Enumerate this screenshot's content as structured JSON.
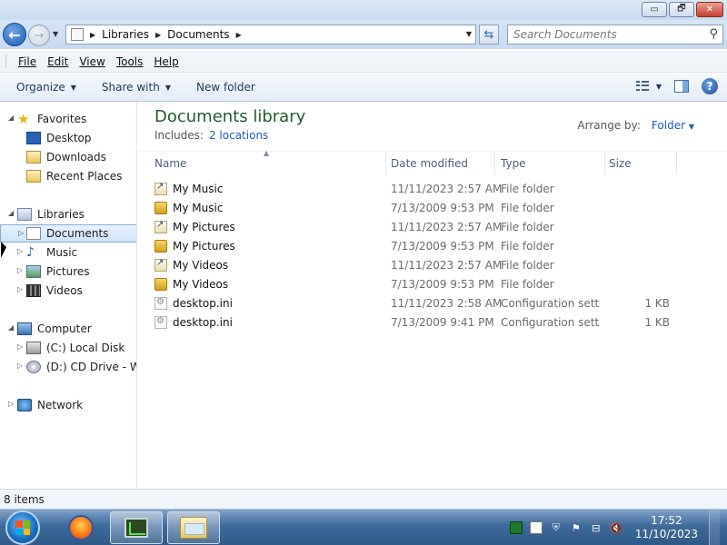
{
  "window": {
    "minimize_glyph": "▭",
    "maximize_glyph": "🗗",
    "close_glyph": "✕"
  },
  "navigation": {
    "back_glyph": "←",
    "forward_glyph": "→",
    "history_glyph": "▼"
  },
  "address": {
    "crumbs": [
      "Libraries",
      "Documents"
    ],
    "separator": "▶",
    "refresh_glyph": "⇆"
  },
  "search": {
    "placeholder": "Search Documents",
    "icon": "search-icon",
    "glyph": "⚲"
  },
  "menubar": {
    "items": [
      "File",
      "Edit",
      "View",
      "Tools",
      "Help"
    ]
  },
  "toolbar": {
    "organize": "Organize",
    "share_with": "Share with",
    "new_folder": "New folder",
    "caret": "▼",
    "help": "?"
  },
  "navpane": {
    "items": [
      {
        "label": "Favorites",
        "icon": "star-icon"
      },
      {
        "label": "Desktop",
        "icon": "desktop-icon"
      },
      {
        "label": "Downloads",
        "icon": "downloads-icon"
      },
      {
        "label": "Recent Places",
        "icon": "recent-places-icon"
      },
      {
        "label": "Libraries",
        "icon": "libraries-icon"
      },
      {
        "label": "Documents",
        "icon": "documents-icon"
      },
      {
        "label": "Music",
        "icon": "music-icon"
      },
      {
        "label": "Pictures",
        "icon": "pictures-icon"
      },
      {
        "label": "Videos",
        "icon": "videos-icon"
      },
      {
        "label": "Computer",
        "icon": "computer-icon"
      },
      {
        "label": "(C:) Local Disk",
        "icon": "local-disk-icon"
      },
      {
        "label": "(D:) CD Drive - Win",
        "icon": "cd-drive-icon"
      },
      {
        "label": "Network",
        "icon": "network-icon"
      }
    ],
    "expanded_glyph": "◢",
    "collapsed_glyph": "▷"
  },
  "library": {
    "title": "Documents library",
    "includes_label": "Includes:",
    "locations_link": "2 locations",
    "arrange_label": "Arrange by:",
    "arrange_value": "Folder",
    "arrange_caret": "▼"
  },
  "columns": {
    "name": "Name",
    "date": "Date modified",
    "type": "Type",
    "size": "Size",
    "sort_glyph": "▲"
  },
  "files": [
    {
      "name": "My Music",
      "date": "11/11/2023 2:57 AM",
      "type": "File folder",
      "size": "",
      "icon": "folder-link-icon"
    },
    {
      "name": "My Music",
      "date": "7/13/2009 9:53 PM",
      "type": "File folder",
      "size": "",
      "icon": "locked-folder-icon"
    },
    {
      "name": "My Pictures",
      "date": "11/11/2023 2:57 AM",
      "type": "File folder",
      "size": "",
      "icon": "folder-link-icon"
    },
    {
      "name": "My Pictures",
      "date": "7/13/2009 9:53 PM",
      "type": "File folder",
      "size": "",
      "icon": "locked-folder-icon"
    },
    {
      "name": "My Videos",
      "date": "11/11/2023 2:57 AM",
      "type": "File folder",
      "size": "",
      "icon": "folder-link-icon"
    },
    {
      "name": "My Videos",
      "date": "7/13/2009 9:53 PM",
      "type": "File folder",
      "size": "",
      "icon": "locked-folder-icon"
    },
    {
      "name": "desktop.ini",
      "date": "11/11/2023 2:58 AM",
      "type": "Configuration sett...",
      "size": "1 KB",
      "icon": "ini-file-icon"
    },
    {
      "name": "desktop.ini",
      "date": "7/13/2009 9:41 PM",
      "type": "Configuration sett...",
      "size": "1 KB",
      "icon": "ini-file-icon"
    }
  ],
  "status": {
    "item_count": "8 items"
  },
  "taskbar": {
    "apps": [
      "firefox-icon",
      "task-manager-icon",
      "windows-explorer-icon"
    ],
    "tray_icons": [
      "processor-icon",
      "document-icon",
      "security-icon",
      "flag-icon",
      "network-icon",
      "volume-muted-icon"
    ],
    "clock_time": "17:52",
    "clock_date": "11/10/2023"
  }
}
